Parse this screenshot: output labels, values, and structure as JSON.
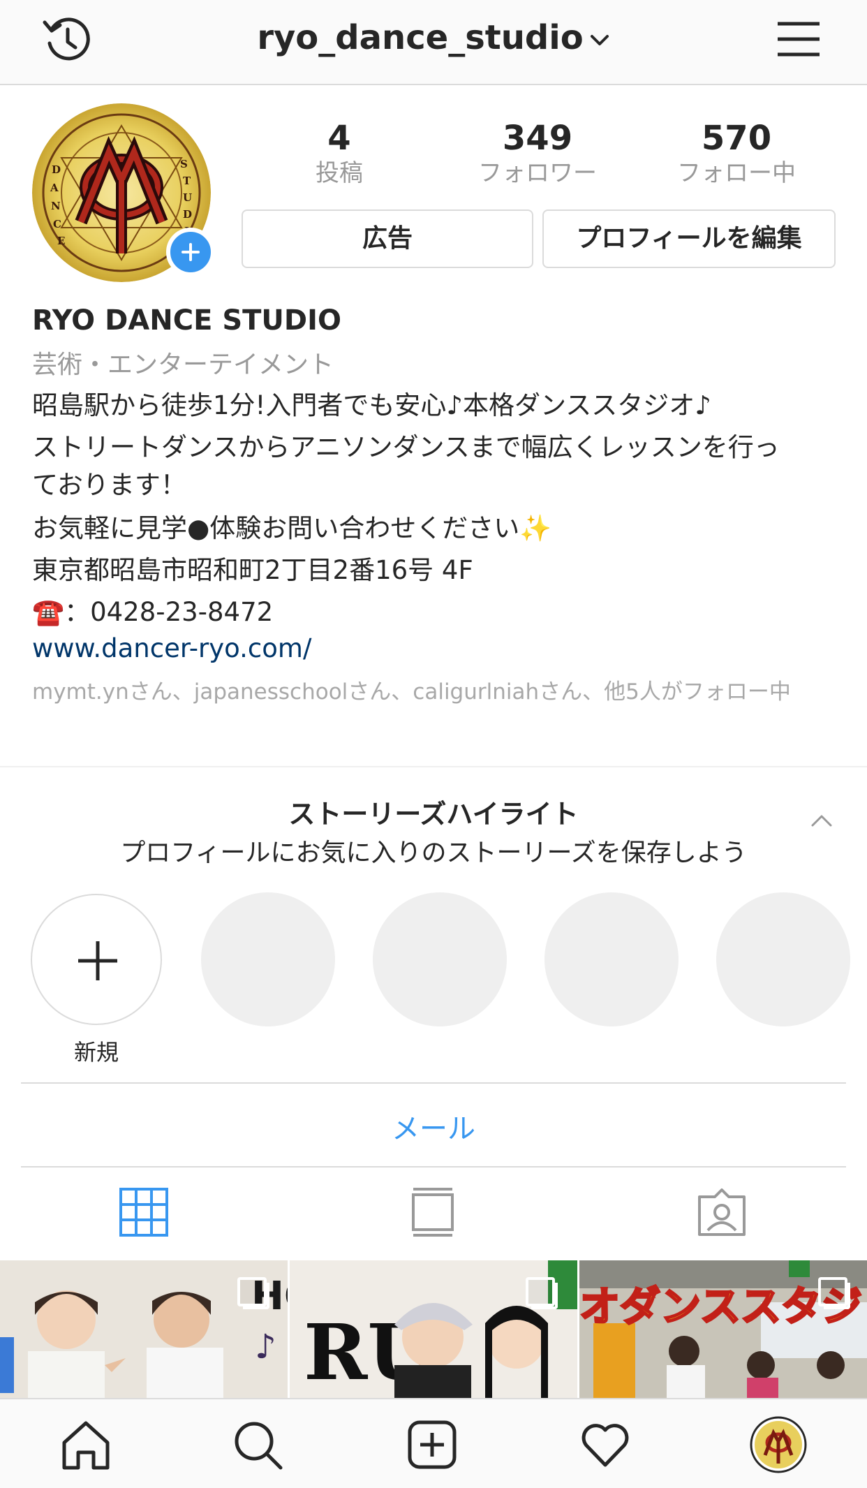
{
  "header": {
    "username": "ryo_dance_studio",
    "icons": [
      "history-icon",
      "chevron-down-icon",
      "hamburger-menu-icon"
    ]
  },
  "profile": {
    "avatar_text_left": "DANCE",
    "avatar_text_right": "STUDIO",
    "stats": [
      {
        "value": "4",
        "label": "投稿"
      },
      {
        "value": "349",
        "label": "フォロワー"
      },
      {
        "value": "570",
        "label": "フォロー中"
      }
    ],
    "buttons": {
      "ads": "広告",
      "edit_profile": "プロフィールを編集"
    },
    "name": "RYO DANCE STUDIO",
    "category": "芸術・エンターテイメント",
    "bio": [
      "昭島駅から徒歩1分!入門者でも安心♪本格ダンススタジオ♪",
      "ストリートダンスからアニソンダンスまで幅広くレッスンを行っ",
      "ております！",
      "お気軽に見学●体験お問い合わせください✨",
      "東京都昭島市昭和町2丁目2番16号 4F",
      "☎️：0428-23-8472"
    ],
    "link": "www.dancer-ryo.com/",
    "followed_by": "mymt.ynさん、japanesschoolさん、caligurlniahさん、他5人がフォロー中"
  },
  "highlights": {
    "title": "ストーリーズハイライト",
    "subtitle": "プロフィールにお気に入りのストーリーズを保存しよう",
    "new_label": "新規"
  },
  "contact": {
    "email_label": "メール"
  },
  "tabs": [
    "grid-icon",
    "feed-icon",
    "tagged-icon"
  ],
  "posts": [
    {
      "id": "post-1",
      "overlay_text": "HO"
    },
    {
      "id": "post-2",
      "overlay_text": "RU"
    },
    {
      "id": "post-3",
      "overlay_text": "オダンススタジ"
    }
  ],
  "colors": {
    "accent": "#3897f0",
    "link": "#003569",
    "secondary": "#999999",
    "border": "#dbdbdb"
  }
}
